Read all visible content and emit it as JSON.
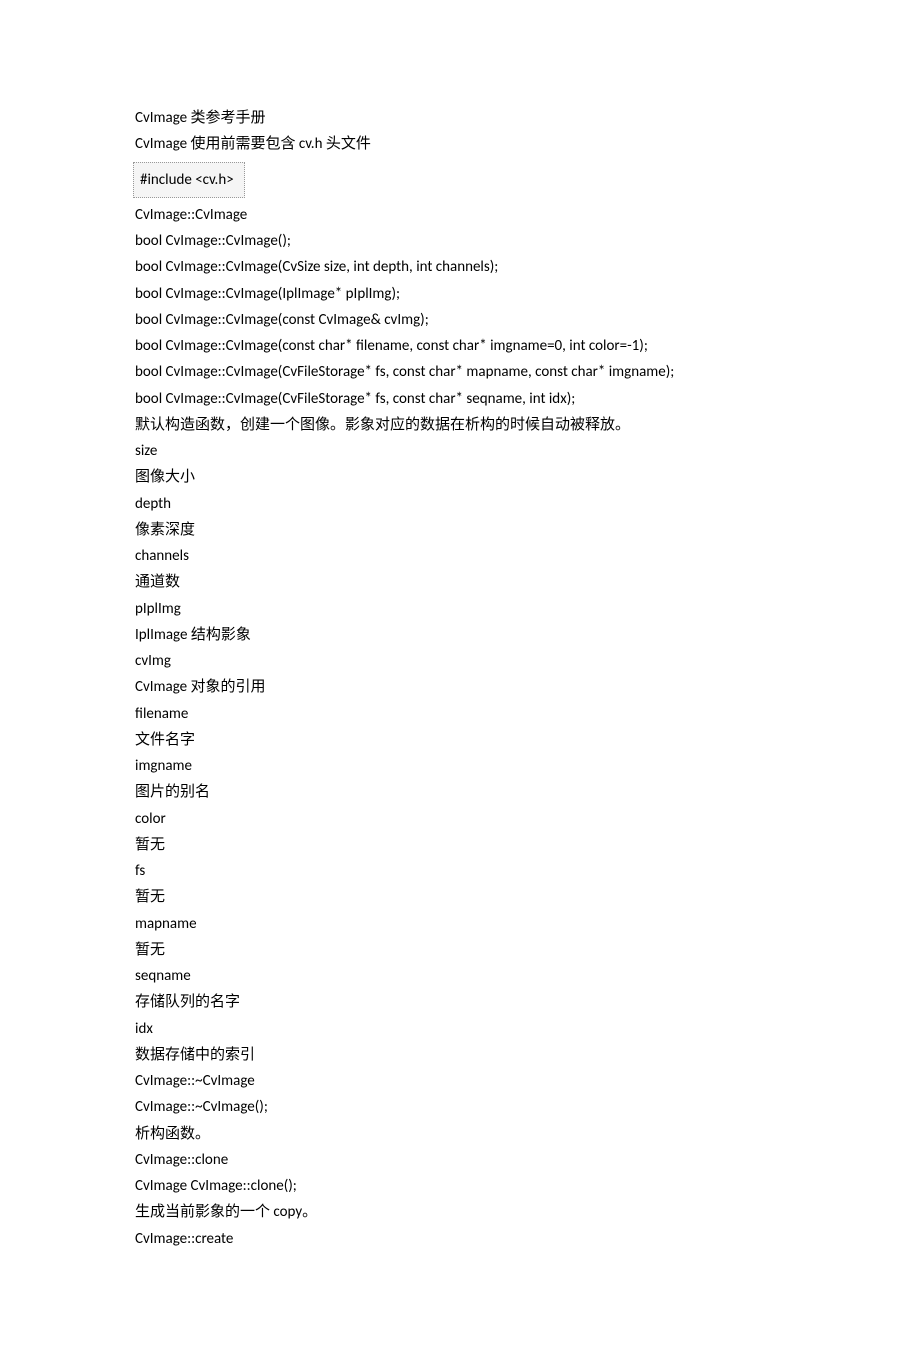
{
  "title": "CvImage 类参考手册",
  "intro": "CvImage 使用前需要包含  cv.h  头文件",
  "include_code": "#include <cv.h>",
  "sections": {
    "ctor": {
      "heading": "CvImage::CvImage",
      "sigs": [
        "bool CvImage::CvImage();",
        "bool CvImage::CvImage(CvSize size, int depth, int channels);",
        "bool CvImage::CvImage(IplImage* pIplImg);",
        "bool CvImage::CvImage(const CvImage& cvImg);",
        "bool CvImage::CvImage(const char* filename, const char* imgname=0, int color=-1);",
        "bool CvImage::CvImage(CvFileStorage* fs, const char* mapname, const char* imgname);",
        "bool CvImage::CvImage(CvFileStorage* fs, const char* seqname, int idx);"
      ],
      "desc": "默认构造函数，创建一个图像。影象对应的数据在析构的时候自动被释放。",
      "params": [
        {
          "name": "size",
          "desc": "图像大小"
        },
        {
          "name": "depth",
          "desc": "像素深度"
        },
        {
          "name": "channels",
          "desc": "通道数"
        },
        {
          "name": "pIplImg",
          "desc": "IplImage 结构影象"
        },
        {
          "name": "cvImg",
          "desc": "CvImage 对象的引用"
        },
        {
          "name": "filename",
          "desc": "文件名字"
        },
        {
          "name": "imgname",
          "desc": "图片的别名"
        },
        {
          "name": "color",
          "desc": "暂无"
        },
        {
          "name": "fs",
          "desc": "暂无"
        },
        {
          "name": "mapname",
          "desc": "暂无"
        },
        {
          "name": "seqname",
          "desc": "存储队列的名字"
        },
        {
          "name": "idx",
          "desc": "数据存储中的索引"
        }
      ]
    },
    "dtor": {
      "heading": "CvImage::~CvImage",
      "sig": "CvImage::~CvImage();",
      "desc": "析构函数。"
    },
    "clone": {
      "heading": "CvImage::clone",
      "sig": "CvImage CvImage::clone();",
      "desc": "生成当前影象的一个 copy。"
    },
    "create": {
      "heading": "CvImage::create"
    }
  }
}
